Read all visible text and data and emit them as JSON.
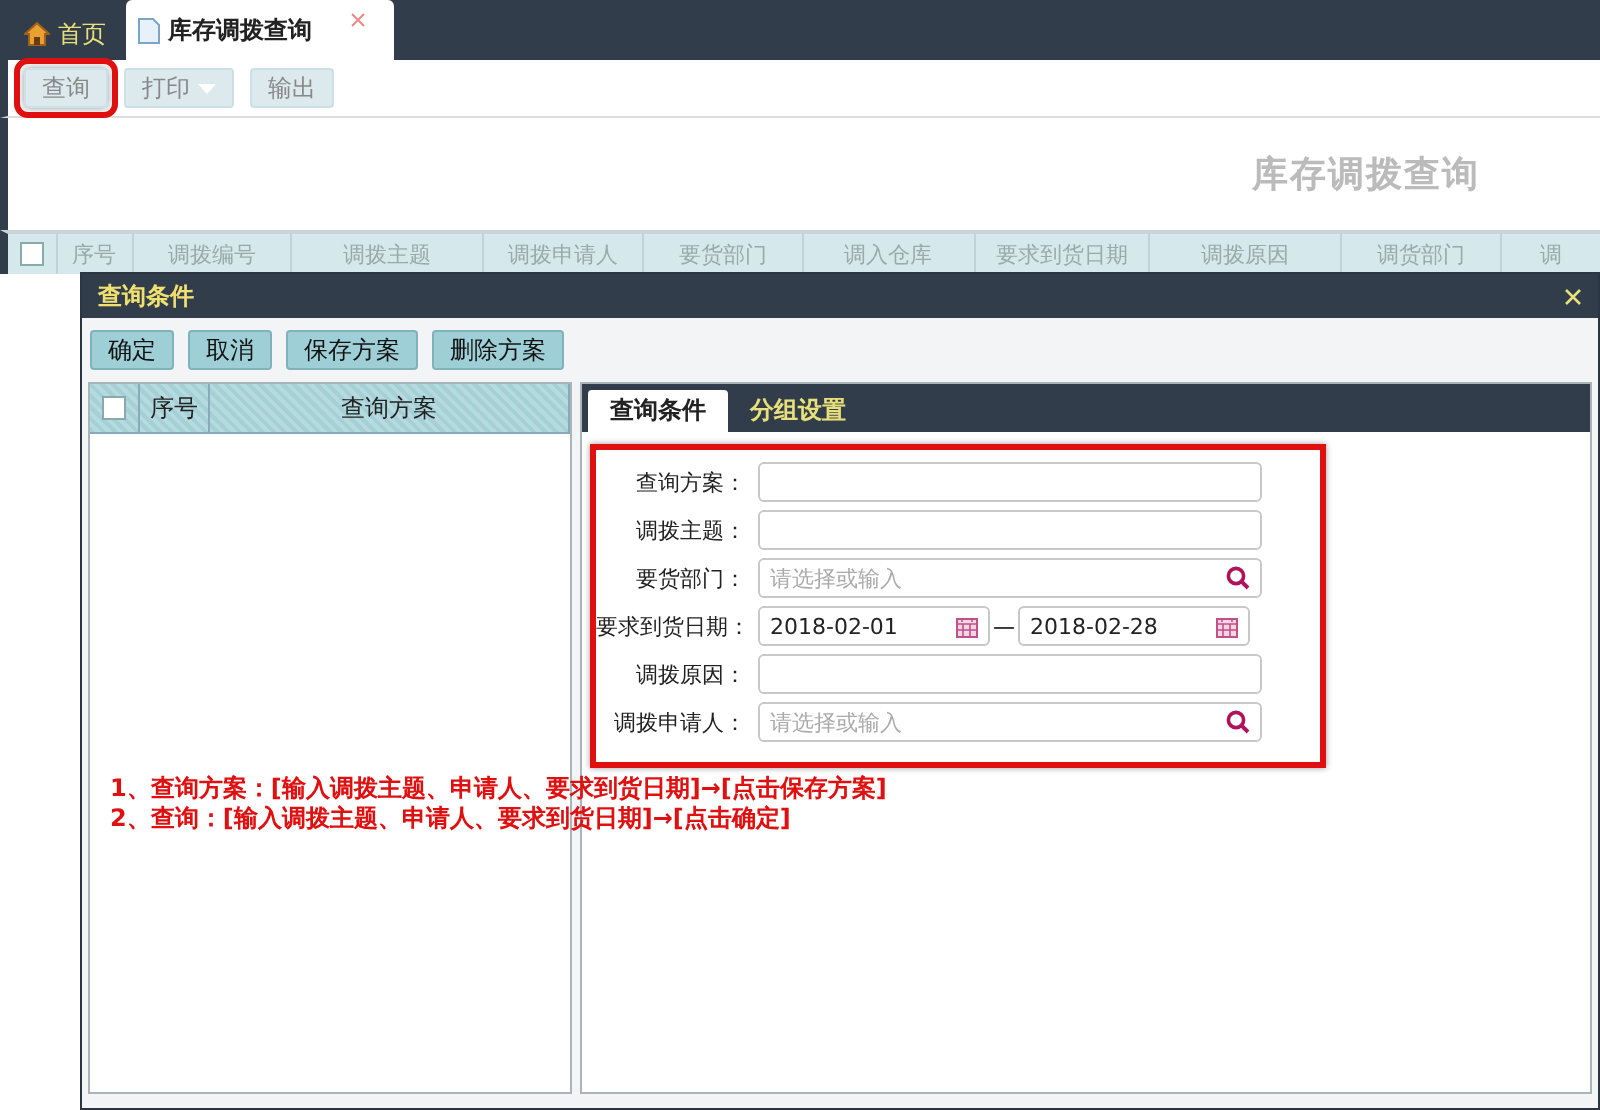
{
  "tabs": [
    {
      "label": "首页",
      "kind": "home",
      "selected": false,
      "closable": false
    },
    {
      "label": "库存调拨查询",
      "kind": "doc",
      "selected": true,
      "closable": true
    }
  ],
  "toolbar": {
    "buttons": [
      {
        "label": "查询",
        "highlighted": true,
        "dropdown": false
      },
      {
        "label": "打印",
        "highlighted": false,
        "dropdown": true
      },
      {
        "label": "输出",
        "highlighted": false,
        "dropdown": false
      }
    ]
  },
  "page_title": "库存调拨查询",
  "grid": {
    "select_all": {
      "checked": false
    },
    "columns": [
      "序号",
      "调拨编号",
      "调拨主题",
      "调拨申请人",
      "要货部门",
      "调入仓库",
      "要求到货日期",
      "调拨原因",
      "调货部门",
      "调"
    ]
  },
  "dialog": {
    "title": "查询条件",
    "buttons": [
      "确定",
      "取消",
      "保存方案",
      "删除方案"
    ],
    "scheme_list": {
      "select_all": {
        "checked": false
      },
      "columns": [
        "序号",
        "查询方案"
      ]
    },
    "tabs": [
      {
        "label": "查询条件",
        "selected": true
      },
      {
        "label": "分组设置",
        "selected": false
      }
    ],
    "fields_highlighted": true,
    "fields": [
      {
        "label": "查询方案：",
        "kind": "text"
      },
      {
        "label": "调拨主题：",
        "kind": "text"
      },
      {
        "label": "要货部门：",
        "kind": "lookup",
        "placeholder": "请选择或输入"
      },
      {
        "label": "要求到货日期：",
        "kind": "date_range",
        "from": "2018-02-01",
        "separator": "—",
        "to": "2018-02-28"
      },
      {
        "label": "调拨原因：",
        "kind": "text"
      },
      {
        "label": "调拨申请人：",
        "kind": "lookup",
        "placeholder": "请选择或输入"
      }
    ],
    "notes": [
      "1、查询方案：[输入调拨主题、申请人、要求到货日期]→[点击保存方案]",
      "2、查询：[输入调拨主题、申请人、要求到货日期]→[点击确定]"
    ]
  }
}
